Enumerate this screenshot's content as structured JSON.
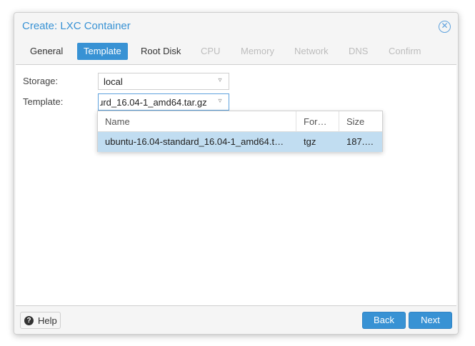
{
  "window": {
    "title": "Create: LXC Container"
  },
  "tabs": [
    {
      "label": "General",
      "state": "normal"
    },
    {
      "label": "Template",
      "state": "active"
    },
    {
      "label": "Root Disk",
      "state": "normal"
    },
    {
      "label": "CPU",
      "state": "disabled"
    },
    {
      "label": "Memory",
      "state": "disabled"
    },
    {
      "label": "Network",
      "state": "disabled"
    },
    {
      "label": "DNS",
      "state": "disabled"
    },
    {
      "label": "Confirm",
      "state": "disabled"
    }
  ],
  "form": {
    "storage_label": "Storage:",
    "storage_value": "local",
    "template_label": "Template:",
    "template_value": "ɹrd_16.04-1_amd64.tar.gz"
  },
  "dropdown": {
    "columns": [
      "Name",
      "For…",
      "Size"
    ],
    "rows": [
      {
        "name": "ubuntu-16.04-standard_16.04-1_amd64.t…",
        "format": "tgz",
        "size": "187.…"
      }
    ]
  },
  "footer": {
    "help_label": "Help",
    "back_label": "Back",
    "next_label": "Next"
  },
  "colors": {
    "accent": "#3892d4",
    "selected_row": "#c1ddf1",
    "disabled_text": "#bdbdbd"
  }
}
